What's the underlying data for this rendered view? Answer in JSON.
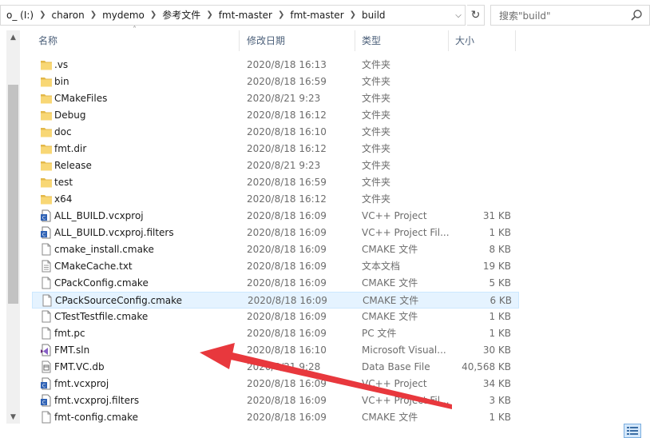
{
  "address": {
    "crumbs": [
      "o_ (I:)",
      "charon",
      "mydemo",
      "参考文件",
      "fmt-master",
      "fmt-master",
      "build"
    ]
  },
  "search": {
    "placeholder": "搜索\"build\""
  },
  "columns": {
    "name": "名称",
    "date": "修改日期",
    "type": "类型",
    "size": "大小"
  },
  "files": [
    {
      "name": ".vs",
      "date": "2020/8/18 16:13",
      "type": "文件夹",
      "size": "",
      "icon": "folder-icon"
    },
    {
      "name": "bin",
      "date": "2020/8/18 16:59",
      "type": "文件夹",
      "size": "",
      "icon": "folder-icon"
    },
    {
      "name": "CMakeFiles",
      "date": "2020/8/21 9:23",
      "type": "文件夹",
      "size": "",
      "icon": "folder-icon"
    },
    {
      "name": "Debug",
      "date": "2020/8/18 16:12",
      "type": "文件夹",
      "size": "",
      "icon": "folder-icon"
    },
    {
      "name": "doc",
      "date": "2020/8/18 16:10",
      "type": "文件夹",
      "size": "",
      "icon": "folder-icon"
    },
    {
      "name": "fmt.dir",
      "date": "2020/8/18 16:12",
      "type": "文件夹",
      "size": "",
      "icon": "folder-icon"
    },
    {
      "name": "Release",
      "date": "2020/8/21 9:23",
      "type": "文件夹",
      "size": "",
      "icon": "folder-icon"
    },
    {
      "name": "test",
      "date": "2020/8/18 16:59",
      "type": "文件夹",
      "size": "",
      "icon": "folder-icon"
    },
    {
      "name": "x64",
      "date": "2020/8/18 16:12",
      "type": "文件夹",
      "size": "",
      "icon": "folder-icon"
    },
    {
      "name": "ALL_BUILD.vcxproj",
      "date": "2020/8/18 16:09",
      "type": "VC++ Project",
      "size": "31 KB",
      "icon": "vcxproj-icon"
    },
    {
      "name": "ALL_BUILD.vcxproj.filters",
      "date": "2020/8/18 16:09",
      "type": "VC++ Project Fil...",
      "size": "1 KB",
      "icon": "vcxproj-icon"
    },
    {
      "name": "cmake_install.cmake",
      "date": "2020/8/18 16:09",
      "type": "CMAKE 文件",
      "size": "8 KB",
      "icon": "file-icon"
    },
    {
      "name": "CMakeCache.txt",
      "date": "2020/8/18 16:09",
      "type": "文本文档",
      "size": "19 KB",
      "icon": "text-file-icon"
    },
    {
      "name": "CPackConfig.cmake",
      "date": "2020/8/18 16:09",
      "type": "CMAKE 文件",
      "size": "5 KB",
      "icon": "file-icon"
    },
    {
      "name": "CPackSourceConfig.cmake",
      "date": "2020/8/18 16:09",
      "type": "CMAKE 文件",
      "size": "6 KB",
      "icon": "file-icon",
      "selected": true
    },
    {
      "name": "CTestTestfile.cmake",
      "date": "2020/8/18 16:09",
      "type": "CMAKE 文件",
      "size": "1 KB",
      "icon": "file-icon"
    },
    {
      "name": "fmt.pc",
      "date": "2020/8/18 16:09",
      "type": "PC 文件",
      "size": "1 KB",
      "icon": "file-icon"
    },
    {
      "name": "FMT.sln",
      "date": "2020/8/18 16:10",
      "type": "Microsoft Visual...",
      "size": "30 KB",
      "icon": "visual-studio-icon"
    },
    {
      "name": "FMT.VC.db",
      "date": "2020/8/21 9:28",
      "type": "Data Base File",
      "size": "40,568 KB",
      "icon": "database-file-icon"
    },
    {
      "name": "fmt.vcxproj",
      "date": "2020/8/18 16:09",
      "type": "VC++ Project",
      "size": "34 KB",
      "icon": "vcxproj-icon"
    },
    {
      "name": "fmt.vcxproj.filters",
      "date": "2020/8/18 16:09",
      "type": "VC++ Project Fil...",
      "size": "3 KB",
      "icon": "vcxproj-icon"
    },
    {
      "name": "fmt-config.cmake",
      "date": "2020/8/18 16:09",
      "type": "CMAKE 文件",
      "size": "1 KB",
      "icon": "file-icon"
    }
  ],
  "colors": {
    "folder": "#f8d775",
    "folder_dark": "#e3b84a",
    "selection": "#e5f3ff",
    "header_text": "#4c607a",
    "annotation_arrow": "#e8383d"
  }
}
